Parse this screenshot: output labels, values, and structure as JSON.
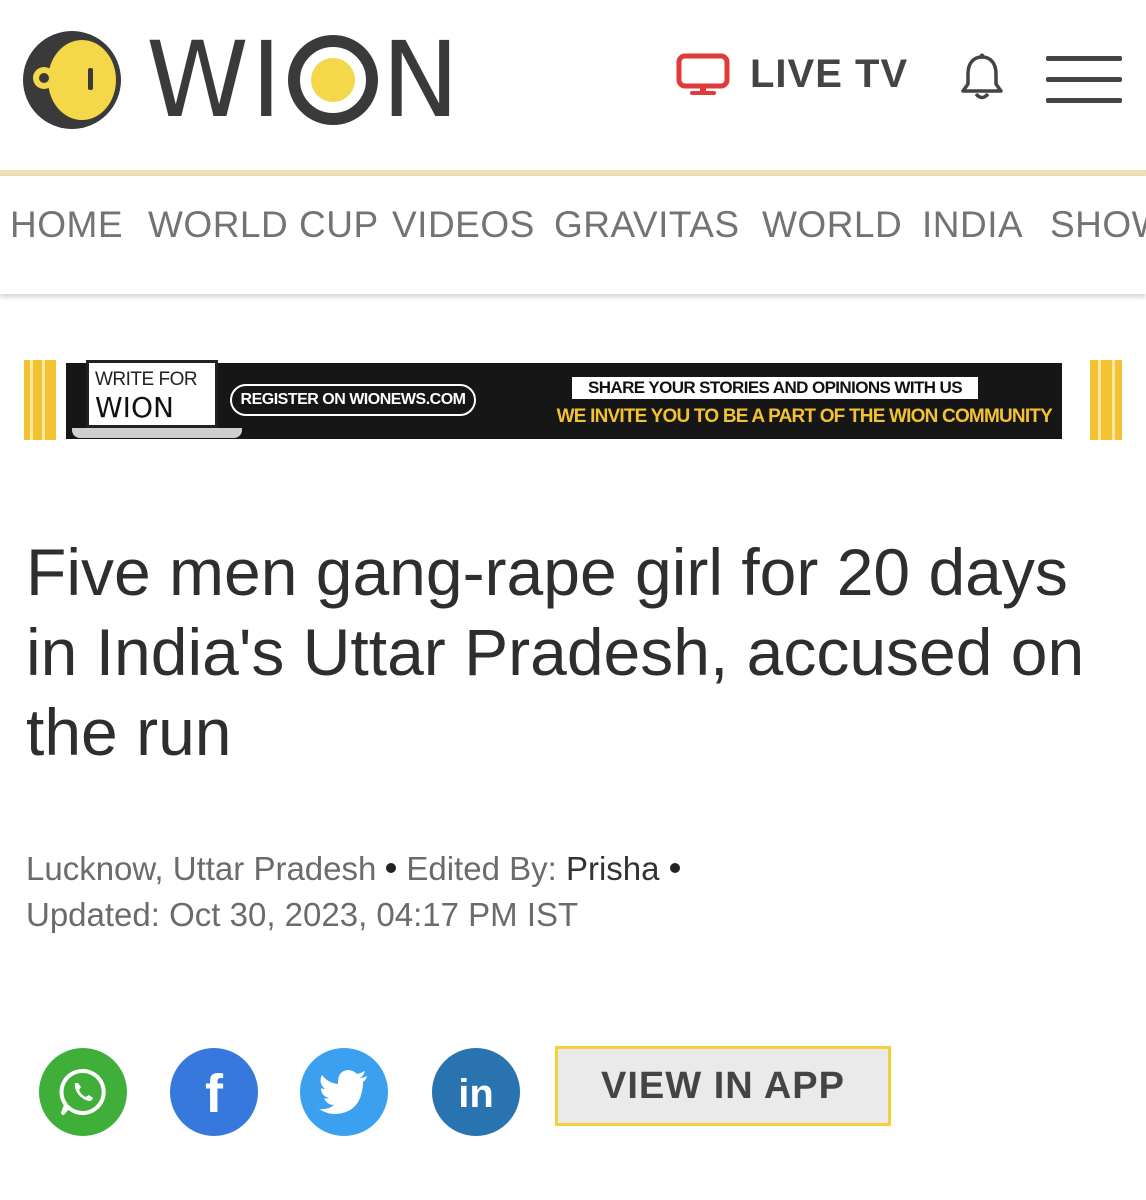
{
  "header": {
    "brand": "WION",
    "brand_prefix": "W",
    "brand_suffix": "N",
    "brand_i": "I",
    "live_tv_label": "LIVE TV",
    "icons": {
      "tv": "tv-icon",
      "bell": "bell-icon",
      "menu": "hamburger-menu-icon"
    },
    "colors": {
      "brand_yellow": "#f5d84a",
      "live_red": "#e03a3a"
    }
  },
  "nav": {
    "items": [
      {
        "label": "HOME"
      },
      {
        "label": "WORLD CUP"
      },
      {
        "label": "VIDEOS"
      },
      {
        "label": "GRAVITAS"
      },
      {
        "label": "WORLD"
      },
      {
        "label": "INDIA"
      },
      {
        "label": "SHOW"
      }
    ]
  },
  "banner": {
    "write_for": "WRITE FOR",
    "write_brand": "WION",
    "register": "REGISTER ON WIONEWS.COM",
    "share": "SHARE YOUR STORIES AND OPINIONS WITH US",
    "invite": "WE INVITE YOU TO BE A PART OF THE WION COMMUNITY"
  },
  "article": {
    "headline": "Five men gang-rape girl for 20 days in India's Uttar Pradesh, accused on the run",
    "location": "Lucknow, Uttar Pradesh",
    "edited_by_label": "Edited By:",
    "editor": "Prisha",
    "updated": "Updated: Oct 30, 2023, 04:17 PM IST"
  },
  "share": {
    "buttons": [
      {
        "icon": "whatsapp-icon",
        "color": "#3faf3a"
      },
      {
        "icon": "facebook-icon",
        "glyph": "f",
        "color": "#3778dc"
      },
      {
        "icon": "twitter-icon",
        "color": "#3aa0ef"
      },
      {
        "icon": "linkedin-icon",
        "glyph": "in",
        "color": "#2a73b1"
      }
    ],
    "view_in_app": "VIEW IN APP"
  }
}
